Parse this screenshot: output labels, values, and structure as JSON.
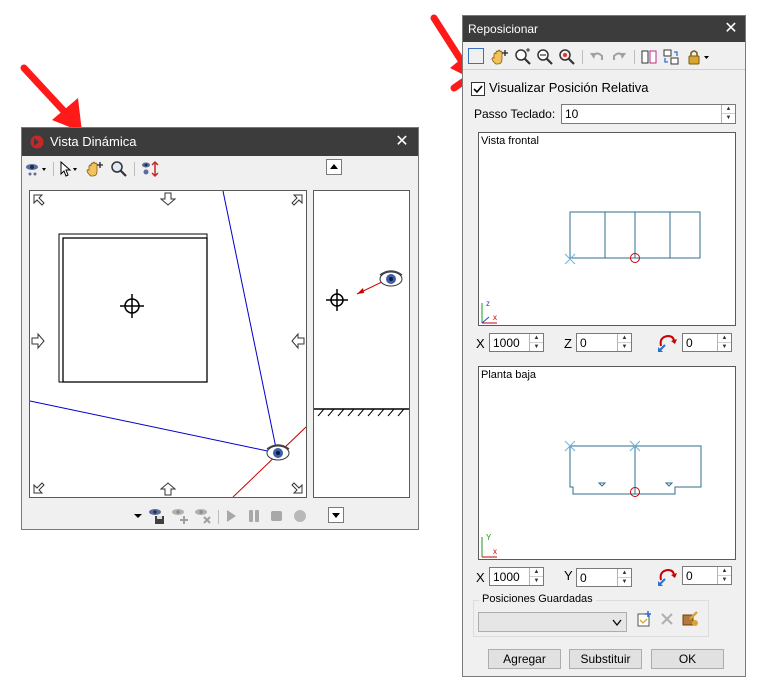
{
  "vista": {
    "title": "Vista Dinámica",
    "close_icon": "close-icon",
    "toolbar_icons": [
      "eye-mode-icon",
      "pointer-icon",
      "hand-pan-icon",
      "zoom-icon",
      "vertical-move-icon"
    ],
    "bottom_icons": [
      "save-position-icon",
      "add-position-icon",
      "delete-position-icon",
      "play-icon",
      "pause-icon",
      "stop-icon",
      "record-icon"
    ]
  },
  "repo": {
    "title": "Reposicionar",
    "checkbox_label": "Visualizar Posición Relativa",
    "checkbox_checked": true,
    "passo_label": "Passo Teclado:",
    "passo_value": "10",
    "frontal": {
      "title": "Vista frontal",
      "x_label": "X",
      "x_value": "1000",
      "z_label": "Z",
      "z_value": "0",
      "rot_value": "0",
      "axis_a": "z",
      "axis_b": "x"
    },
    "planta": {
      "title": "Planta baja",
      "x_label": "X",
      "x_value": "1000",
      "y_label": "Y",
      "y_value": "0",
      "rot_value": "0",
      "axis_a": "Y",
      "axis_b": "x"
    },
    "saved_group": "Posiciones Guardadas",
    "saved_value": "",
    "buttons": {
      "add": "Agregar",
      "replace": "Substituir",
      "ok": "OK"
    }
  },
  "colors": {
    "titlebar": "#3c3c3c",
    "arrow": "#ff1a1a",
    "blue_line": "#0000cc",
    "red_line": "#cc0000",
    "teal": "#2f6f8f"
  }
}
